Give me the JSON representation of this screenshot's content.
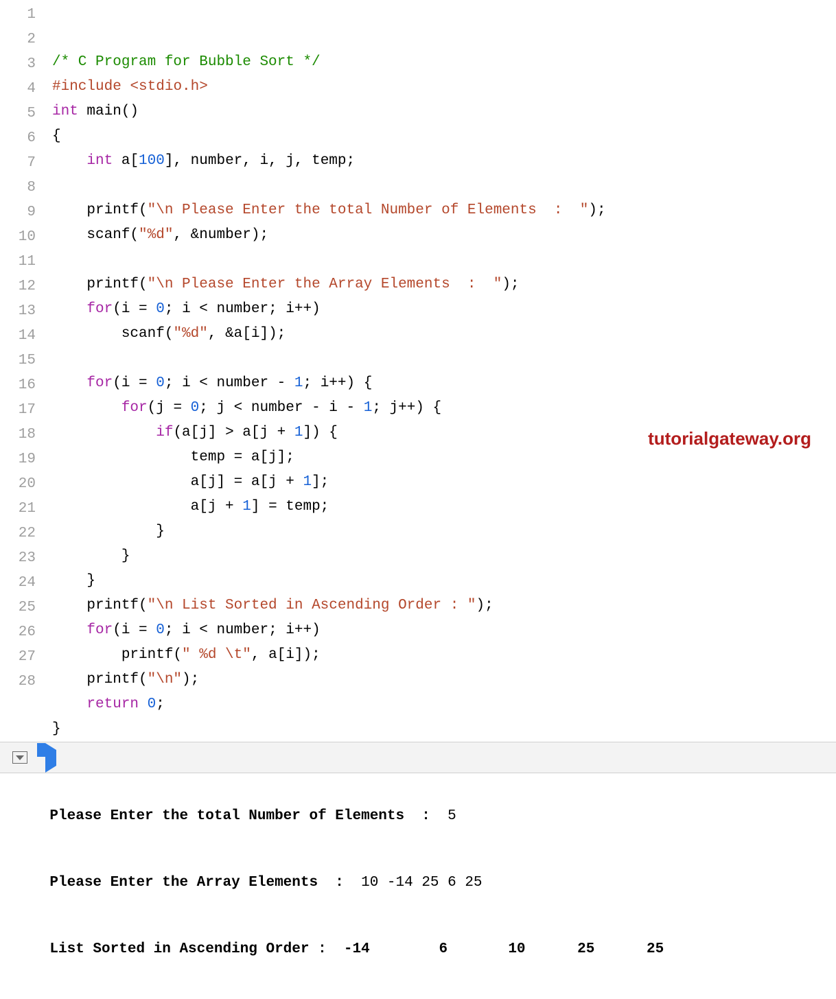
{
  "watermark": "tutorialgateway.org",
  "code_lines": [
    [
      {
        "t": "/* C Program for Bubble Sort */",
        "c": "c-green"
      }
    ],
    [
      {
        "t": "#include",
        "c": "c-pre"
      },
      {
        "t": " ",
        "c": ""
      },
      {
        "t": "<stdio.h>",
        "c": "c-angle"
      }
    ],
    [
      {
        "t": "int",
        "c": "c-kw"
      },
      {
        "t": " main()",
        "c": "c-id"
      }
    ],
    [
      {
        "t": "{",
        "c": "c-id"
      }
    ],
    [
      {
        "t": "    ",
        "c": ""
      },
      {
        "t": "int",
        "c": "c-kw"
      },
      {
        "t": " a[",
        "c": "c-id"
      },
      {
        "t": "100",
        "c": "c-num"
      },
      {
        "t": "], number, i, j, temp;",
        "c": "c-id"
      }
    ],
    [
      {
        "t": "",
        "c": ""
      }
    ],
    [
      {
        "t": "    printf(",
        "c": "c-id"
      },
      {
        "t": "\"\\n Please Enter the total Number of Elements  :  \"",
        "c": "c-str"
      },
      {
        "t": ");",
        "c": "c-id"
      }
    ],
    [
      {
        "t": "    scanf(",
        "c": "c-id"
      },
      {
        "t": "\"%d\"",
        "c": "c-str"
      },
      {
        "t": ", &number);",
        "c": "c-id"
      }
    ],
    [
      {
        "t": "",
        "c": ""
      }
    ],
    [
      {
        "t": "    printf(",
        "c": "c-id"
      },
      {
        "t": "\"\\n Please Enter the Array Elements  :  \"",
        "c": "c-str"
      },
      {
        "t": ");",
        "c": "c-id"
      }
    ],
    [
      {
        "t": "    ",
        "c": ""
      },
      {
        "t": "for",
        "c": "c-kw"
      },
      {
        "t": "(i = ",
        "c": "c-id"
      },
      {
        "t": "0",
        "c": "c-num"
      },
      {
        "t": "; i < number; i++)",
        "c": "c-id"
      }
    ],
    [
      {
        "t": "        scanf(",
        "c": "c-id"
      },
      {
        "t": "\"%d\"",
        "c": "c-str"
      },
      {
        "t": ", &a[i]);",
        "c": "c-id"
      }
    ],
    [
      {
        "t": "",
        "c": ""
      }
    ],
    [
      {
        "t": "    ",
        "c": ""
      },
      {
        "t": "for",
        "c": "c-kw"
      },
      {
        "t": "(i = ",
        "c": "c-id"
      },
      {
        "t": "0",
        "c": "c-num"
      },
      {
        "t": "; i < number - ",
        "c": "c-id"
      },
      {
        "t": "1",
        "c": "c-num"
      },
      {
        "t": "; i++) {",
        "c": "c-id"
      }
    ],
    [
      {
        "t": "        ",
        "c": ""
      },
      {
        "t": "for",
        "c": "c-kw"
      },
      {
        "t": "(j = ",
        "c": "c-id"
      },
      {
        "t": "0",
        "c": "c-num"
      },
      {
        "t": "; j < number - i - ",
        "c": "c-id"
      },
      {
        "t": "1",
        "c": "c-num"
      },
      {
        "t": "; j++) {",
        "c": "c-id"
      }
    ],
    [
      {
        "t": "            ",
        "c": ""
      },
      {
        "t": "if",
        "c": "c-kw"
      },
      {
        "t": "(a[j] > a[j + ",
        "c": "c-id"
      },
      {
        "t": "1",
        "c": "c-num"
      },
      {
        "t": "]) {",
        "c": "c-id"
      }
    ],
    [
      {
        "t": "                temp = a[j];",
        "c": "c-id"
      }
    ],
    [
      {
        "t": "                a[j] = a[j + ",
        "c": "c-id"
      },
      {
        "t": "1",
        "c": "c-num"
      },
      {
        "t": "];",
        "c": "c-id"
      }
    ],
    [
      {
        "t": "                a[j + ",
        "c": "c-id"
      },
      {
        "t": "1",
        "c": "c-num"
      },
      {
        "t": "] = temp;",
        "c": "c-id"
      }
    ],
    [
      {
        "t": "            }",
        "c": "c-id"
      }
    ],
    [
      {
        "t": "        }",
        "c": "c-id"
      }
    ],
    [
      {
        "t": "    }",
        "c": "c-id"
      }
    ],
    [
      {
        "t": "    printf(",
        "c": "c-id"
      },
      {
        "t": "\"\\n List Sorted in Ascending Order : \"",
        "c": "c-str"
      },
      {
        "t": ");",
        "c": "c-id"
      }
    ],
    [
      {
        "t": "    ",
        "c": ""
      },
      {
        "t": "for",
        "c": "c-kw"
      },
      {
        "t": "(i = ",
        "c": "c-id"
      },
      {
        "t": "0",
        "c": "c-num"
      },
      {
        "t": "; i < number; i++)",
        "c": "c-id"
      }
    ],
    [
      {
        "t": "        printf(",
        "c": "c-id"
      },
      {
        "t": "\" %d \\t\"",
        "c": "c-str"
      },
      {
        "t": ", a[i]);",
        "c": "c-id"
      }
    ],
    [
      {
        "t": "    printf(",
        "c": "c-id"
      },
      {
        "t": "\"\\n\"",
        "c": "c-str"
      },
      {
        "t": ");",
        "c": "c-id"
      }
    ],
    [
      {
        "t": "    ",
        "c": ""
      },
      {
        "t": "return",
        "c": "c-kw"
      },
      {
        "t": " ",
        "c": ""
      },
      {
        "t": "0",
        "c": "c-num"
      },
      {
        "t": ";",
        "c": "c-id"
      }
    ],
    [
      {
        "t": "}",
        "c": "c-id"
      }
    ]
  ],
  "console": {
    "line1_prompt": "Please Enter the total Number of Elements  :  ",
    "line1_input": "5",
    "line2_prompt": "Please Enter the Array Elements  :  ",
    "line2_input": "10 -14 25 6 25",
    "line3_prompt": "List Sorted in Ascending Order : ",
    "line3_output": " -14 \t 6 \t 10 \t 25 \t 25 "
  }
}
